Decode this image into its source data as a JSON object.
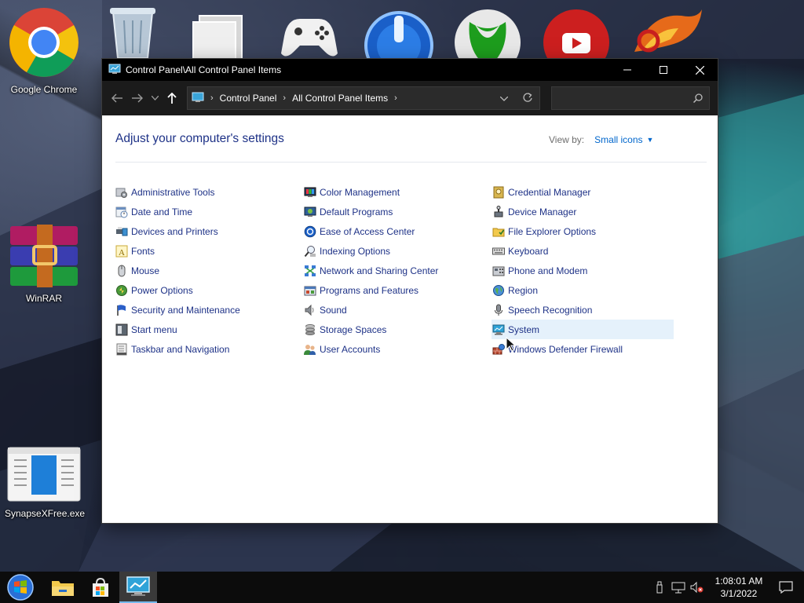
{
  "desktop": {
    "icons": [
      {
        "label": "Google Chrome"
      },
      {
        "label": "WinRAR"
      },
      {
        "label": "SynapseXFree.exe"
      }
    ]
  },
  "window": {
    "title": "Control Panel\\All Control Panel Items",
    "breadcrumbs": [
      "Control Panel",
      "All Control Panel Items"
    ],
    "search_placeholder": "",
    "heading": "Adjust your computer's settings",
    "view_by_label": "View by:",
    "view_by_value": "Small icons",
    "columns": [
      [
        {
          "label": "Administrative Tools",
          "icon": "admin-tools-icon"
        },
        {
          "label": "Date and Time",
          "icon": "clock-calendar-icon"
        },
        {
          "label": "Devices and Printers",
          "icon": "printer-icon"
        },
        {
          "label": "Fonts",
          "icon": "fonts-icon"
        },
        {
          "label": "Mouse",
          "icon": "mouse-icon"
        },
        {
          "label": "Power Options",
          "icon": "power-icon"
        },
        {
          "label": "Security and Maintenance",
          "icon": "flag-icon"
        },
        {
          "label": "Start menu",
          "icon": "start-menu-icon"
        },
        {
          "label": "Taskbar and Navigation",
          "icon": "taskbar-icon"
        }
      ],
      [
        {
          "label": "Color Management",
          "icon": "color-icon"
        },
        {
          "label": "Default Programs",
          "icon": "default-programs-icon"
        },
        {
          "label": "Ease of Access Center",
          "icon": "ease-of-access-icon"
        },
        {
          "label": "Indexing Options",
          "icon": "indexing-icon"
        },
        {
          "label": "Network and Sharing Center",
          "icon": "network-icon"
        },
        {
          "label": "Programs and Features",
          "icon": "programs-icon"
        },
        {
          "label": "Sound",
          "icon": "speaker-icon"
        },
        {
          "label": "Storage Spaces",
          "icon": "storage-icon"
        },
        {
          "label": "User Accounts",
          "icon": "users-icon"
        }
      ],
      [
        {
          "label": "Credential Manager",
          "icon": "credential-icon"
        },
        {
          "label": "Device Manager",
          "icon": "device-manager-icon"
        },
        {
          "label": "File Explorer Options",
          "icon": "folder-options-icon"
        },
        {
          "label": "Keyboard",
          "icon": "keyboard-icon"
        },
        {
          "label": "Phone and Modem",
          "icon": "phone-icon"
        },
        {
          "label": "Region",
          "icon": "globe-icon"
        },
        {
          "label": "Speech Recognition",
          "icon": "microphone-icon"
        },
        {
          "label": "System",
          "icon": "system-monitor-icon"
        },
        {
          "label": "Windows Defender Firewall",
          "icon": "firewall-icon"
        }
      ]
    ]
  },
  "taskbar": {
    "time": "1:08:01 AM",
    "date": "3/1/2022"
  },
  "colors": {
    "link": "#1e3287",
    "accent": "#0066cc",
    "hover": "#e5f1fb"
  }
}
